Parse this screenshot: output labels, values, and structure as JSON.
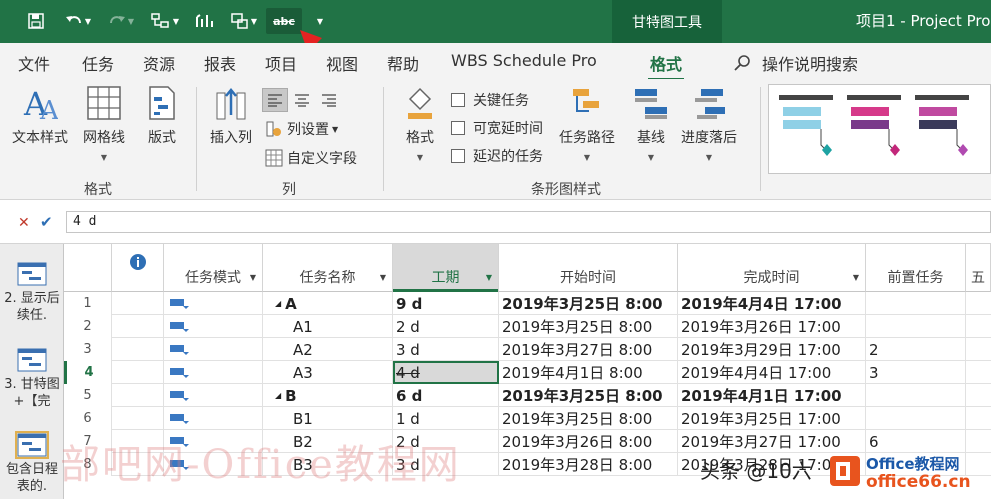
{
  "titlebar": {
    "context_tab": "甘特图工具",
    "app_title": "项目1 - Project Pro",
    "spell_label": "abc"
  },
  "tabs": {
    "items": [
      "文件",
      "任务",
      "资源",
      "报表",
      "项目",
      "视图",
      "帮助",
      "WBS Schedule Pro",
      "格式"
    ],
    "active": "格式",
    "search": "操作说明搜索"
  },
  "ribbon": {
    "text_style": "文本样式",
    "gridlines": "网格线",
    "layout": "版式",
    "group_format": "格式",
    "insert_column": "插入列",
    "column_settings": "列设置",
    "custom_fields": "自定义字段",
    "group_columns": "列",
    "format_btn": "格式",
    "critical_tasks": "关键任务",
    "slack": "可宽延时间",
    "late_tasks": "延迟的任务",
    "task_path": "任务路径",
    "baseline": "基线",
    "slippage": "进度落后",
    "group_bar_styles": "条形图样式"
  },
  "formula": {
    "value": "4 d"
  },
  "views": [
    {
      "label": "2. 显示后续任."
    },
    {
      "label": "3. 甘特图+【完"
    },
    {
      "label": "包含日程表的."
    }
  ],
  "columns": {
    "mode": "任务模式",
    "name": "任务名称",
    "duration": "工期",
    "start": "开始时间",
    "finish": "完成时间",
    "predecessors": "前置任务",
    "extra": "五"
  },
  "rows": [
    {
      "id": "1",
      "name": "A",
      "duration": "9 d",
      "start": "2019年3月25日 8:00",
      "finish": "2019年4月4日 17:00",
      "pred": "",
      "summary": true
    },
    {
      "id": "2",
      "name": "A1",
      "duration": "2 d",
      "start": "2019年3月25日 8:00",
      "finish": "2019年3月26日 17:00",
      "pred": "",
      "summary": false
    },
    {
      "id": "3",
      "name": "A2",
      "duration": "3 d",
      "start": "2019年3月27日 8:00",
      "finish": "2019年3月29日 17:00",
      "pred": "2",
      "summary": false
    },
    {
      "id": "4",
      "name": "A3",
      "duration": "4 d",
      "start": "2019年4月1日 8:00",
      "finish": "2019年4月4日 17:00",
      "pred": "3",
      "summary": false
    },
    {
      "id": "5",
      "name": "B",
      "duration": "6 d",
      "start": "2019年3月25日 8:00",
      "finish": "2019年4月1日 17:00",
      "pred": "",
      "summary": true
    },
    {
      "id": "6",
      "name": "B1",
      "duration": "1 d",
      "start": "2019年3月25日 8:00",
      "finish": "2019年3月25日 17:00",
      "pred": "",
      "summary": false
    },
    {
      "id": "7",
      "name": "B2",
      "duration": "2 d",
      "start": "2019年3月26日 8:00",
      "finish": "2019年3月27日 17:00",
      "pred": "6",
      "summary": false
    },
    {
      "id": "8",
      "name": "B3",
      "duration": "3 d",
      "start": "2019年3月28日 8:00",
      "finish": "2019年3月28日 17:00",
      "pred": "",
      "summary": false
    }
  ],
  "watermark": {
    "text1": "部吧网-Office教程网",
    "text2": "头条 @10六",
    "text3": "Office教程网",
    "text4": "office66.cn"
  }
}
